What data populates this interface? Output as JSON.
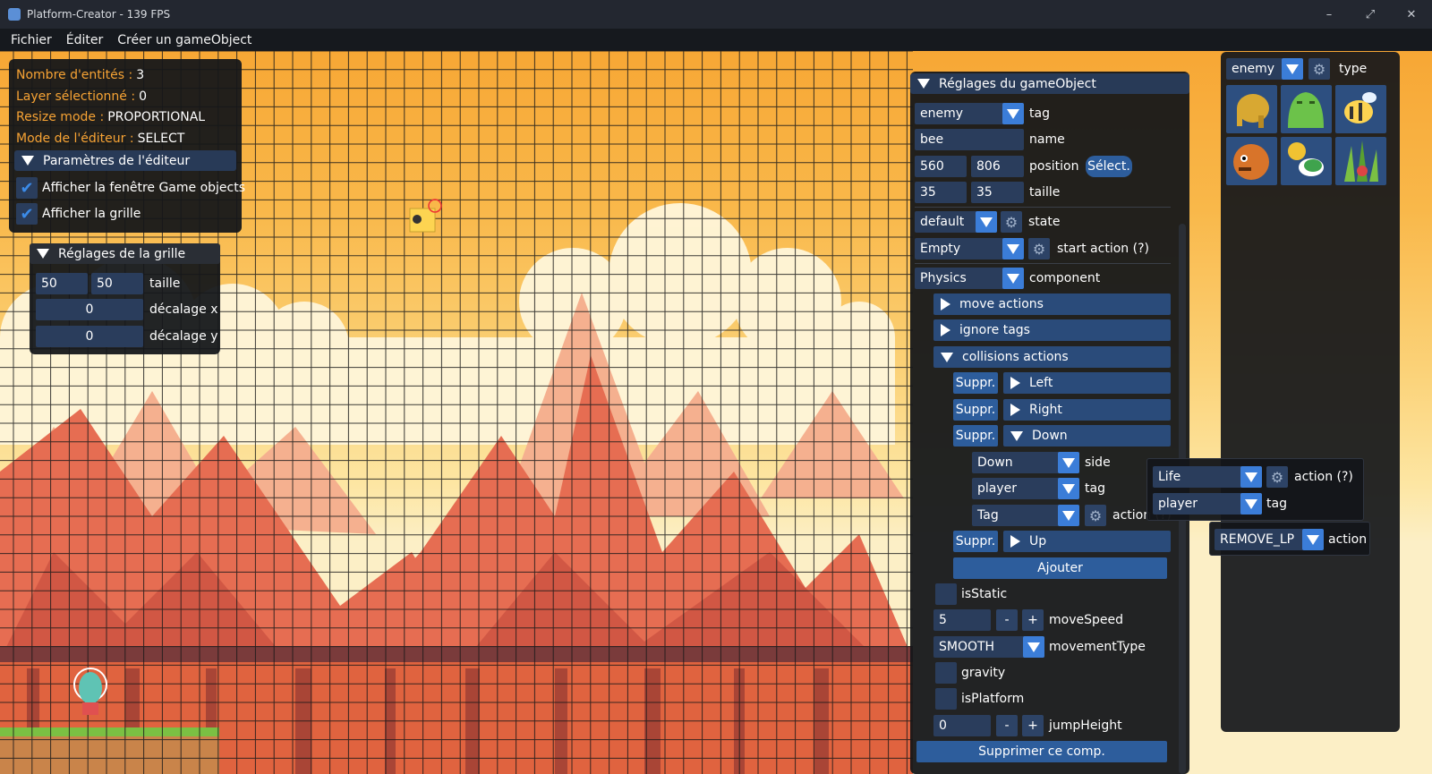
{
  "window": {
    "title": "Platform-Creator - 139 FPS",
    "minimize": "–",
    "maximize": "⤢",
    "close": "✕"
  },
  "menu": {
    "items": [
      "Fichier",
      "Éditer",
      "Créer un gameObject"
    ]
  },
  "colors": {
    "accent": "#3b7dd8",
    "header": "#283a57",
    "field": "#2a3d5c",
    "orange_label": "#f7a334",
    "sky_top": "#f7a735",
    "rock": "#e0654a",
    "ground": "#d95a36"
  },
  "info_panel": {
    "entities_label": "Nombre d'entités :",
    "entities_value": "3",
    "layer_label": "Layer sélectionné :",
    "layer_value": "0",
    "resize_label": "Resize mode :",
    "resize_value": "PROPORTIONAL",
    "mode_label": "Mode de l'éditeur :",
    "mode_value": "SELECT",
    "params_header": "Paramètres de l'éditeur",
    "show_gameobjects": "Afficher la fenêtre Game objects",
    "show_grid": "Afficher la grille",
    "check_icon": "checkmark-icon"
  },
  "grid_panel": {
    "header": "Réglages de la grille",
    "size_w": "50",
    "size_h": "50",
    "size_label": "taille",
    "offset_x": "0",
    "offset_x_label": "décalage x",
    "offset_y": "0",
    "offset_y_label": "décalage y"
  },
  "go_panel": {
    "header": "Réglages du gameObject",
    "tag_value": "enemy",
    "tag_label": "tag",
    "name_value": "bee",
    "name_label": "name",
    "pos_x": "560",
    "pos_y": "806",
    "pos_label": "position",
    "select_button": "Sélect.",
    "size_w": "35",
    "size_h": "35",
    "size_label": "taille",
    "state_value": "default",
    "state_label": "state",
    "start_action_value": "Empty",
    "start_action_label": "start action (?)",
    "component_value": "Physics",
    "component_label": "component",
    "move_actions": "move actions",
    "ignore_tags": "ignore tags",
    "collisions_actions": "collisions actions",
    "delete_label": "Suppr.",
    "side_left": "Left",
    "side_right": "Right",
    "side_down": "Down",
    "side_up": "Up",
    "down_side_value": "Down",
    "down_side_label": "side",
    "down_tag_value": "player",
    "down_tag_label": "tag",
    "down_action_value": "Tag",
    "down_action_label": "action (?)",
    "add_button": "Ajouter",
    "is_static": "isStatic",
    "move_speed_value": "5",
    "move_speed_label": "moveSpeed",
    "minus": "-",
    "plus": "+",
    "movement_type_value": "SMOOTH",
    "movement_type_label": "movementType",
    "gravity": "gravity",
    "is_platform": "isPlatform",
    "jump_height_value": "0",
    "jump_height_label": "jumpHeight",
    "delete_component": "Supprimer ce comp."
  },
  "type_panel": {
    "type_value": "enemy",
    "type_label": "type",
    "thumbs": [
      "elephant-sprite",
      "slime-sprite",
      "bee-sprite",
      "hedgehog-sprite",
      "turtle-sprite",
      "plant-sprite"
    ]
  },
  "popup_tag": {
    "action_value": "Life",
    "action_label": "action (?)",
    "tag_value": "player",
    "tag_label": "tag"
  },
  "popup_life": {
    "action_value": "REMOVE_LP",
    "action_label": "action"
  }
}
